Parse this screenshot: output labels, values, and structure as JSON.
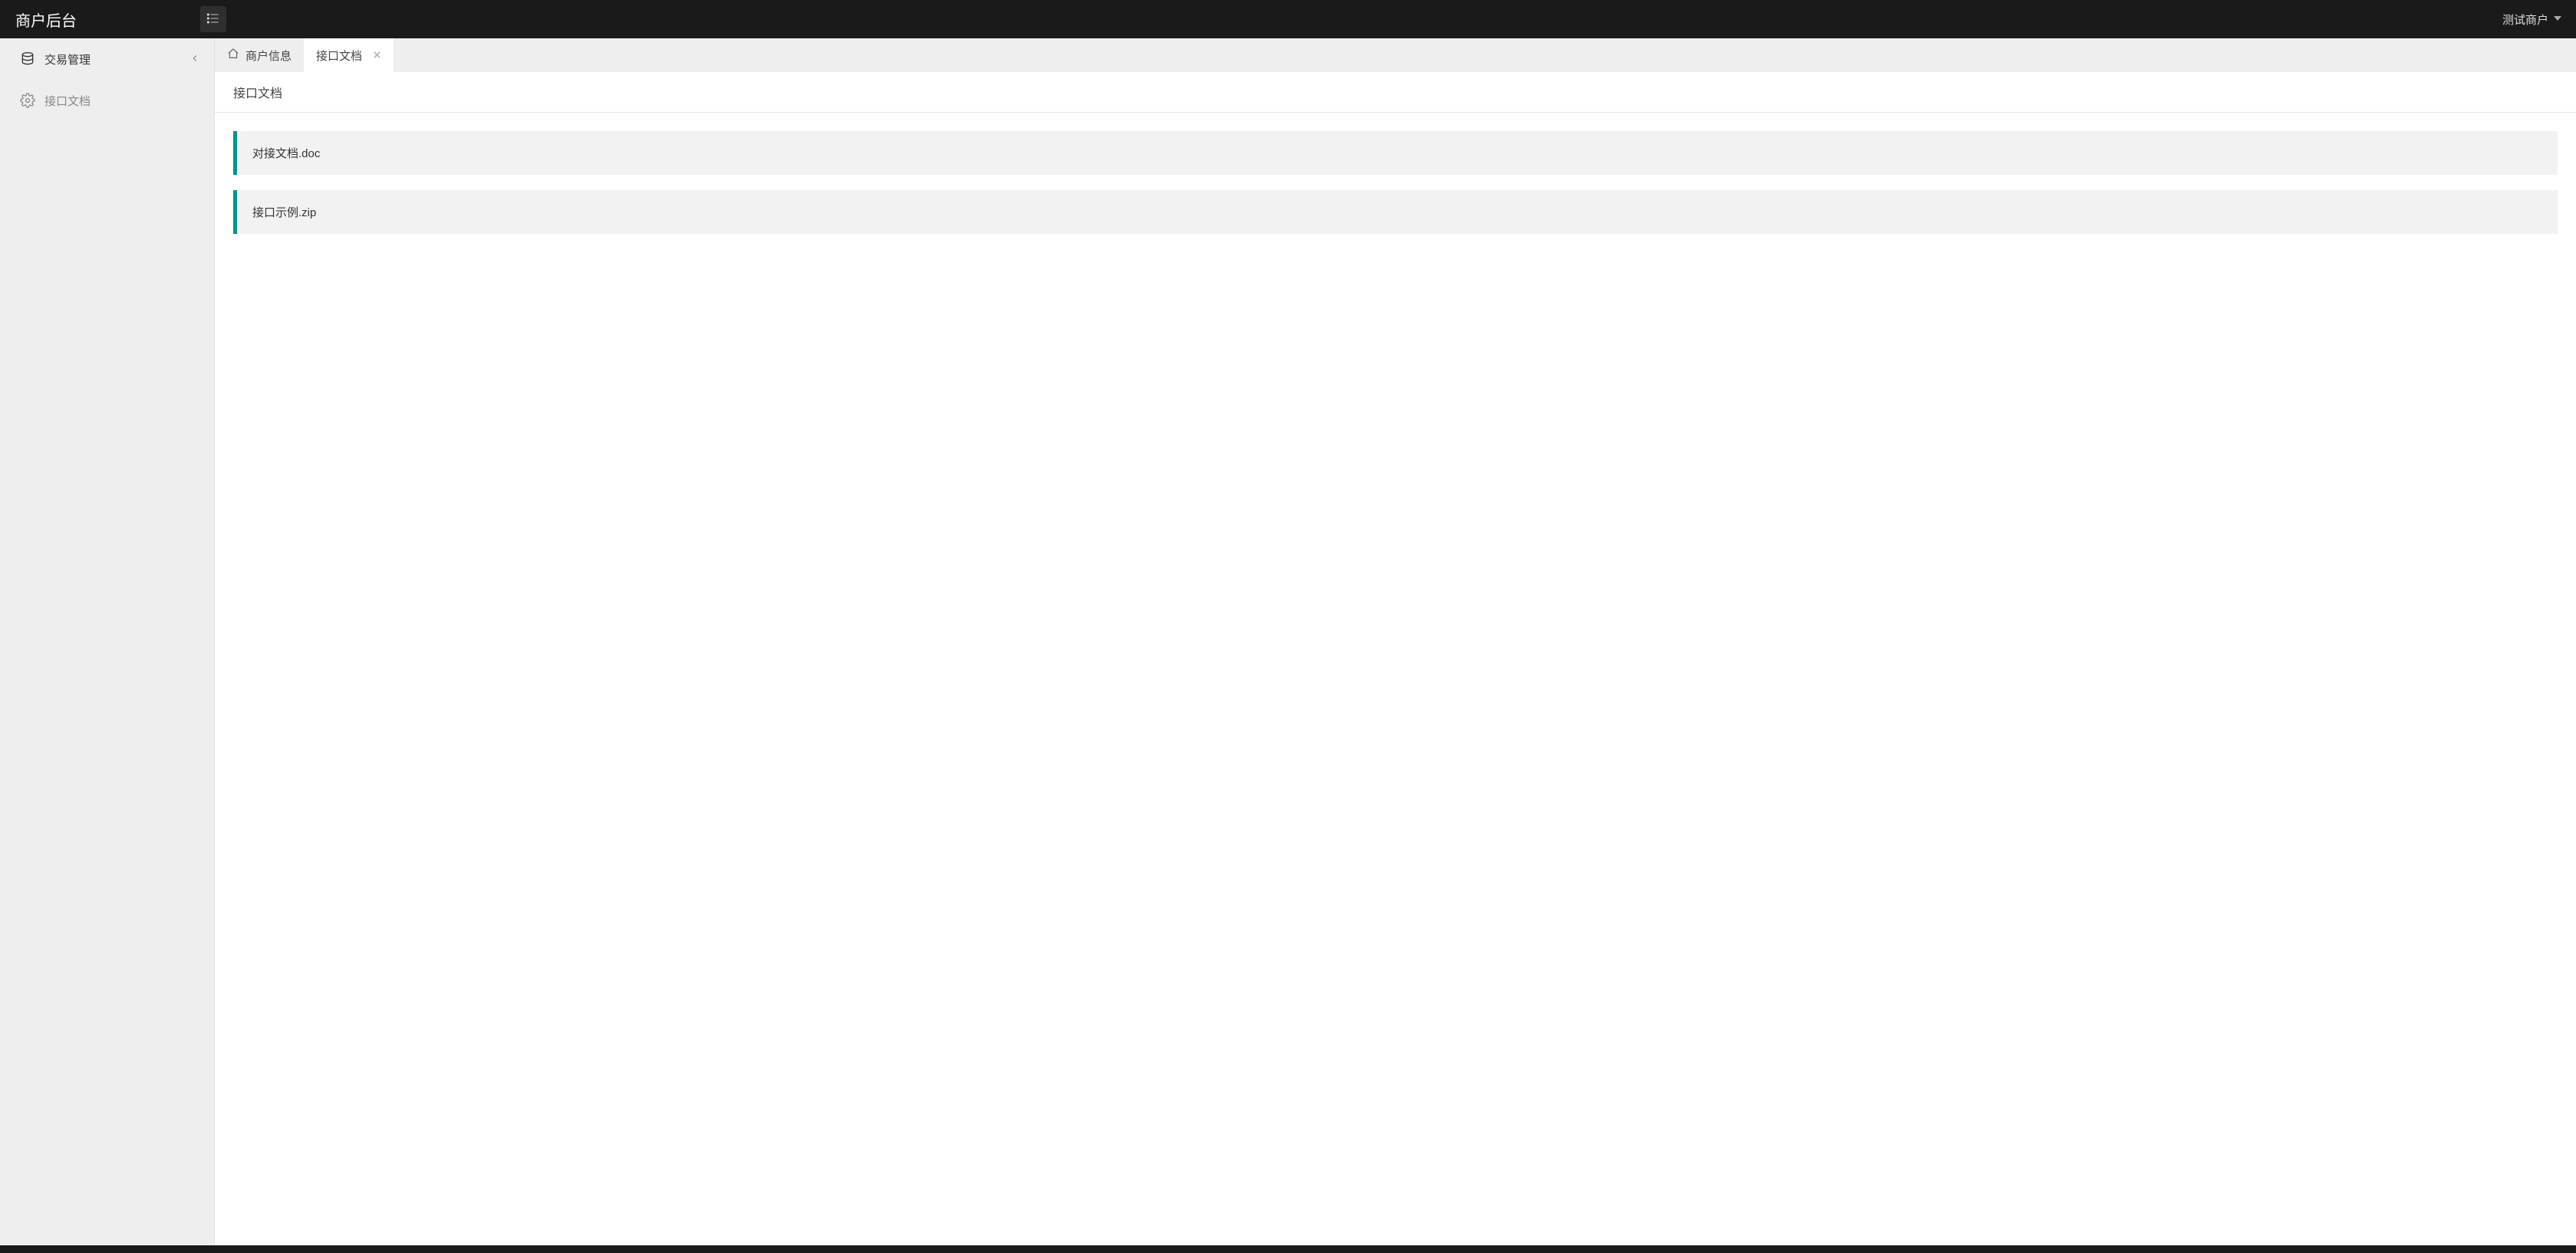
{
  "header": {
    "brand": "商户后台",
    "user_name": "测试商户"
  },
  "sidebar": {
    "items": [
      {
        "label": "交易管理"
      },
      {
        "label": "接口文档"
      }
    ]
  },
  "tabs": [
    {
      "label": "商户信息"
    },
    {
      "label": "接口文档"
    }
  ],
  "page": {
    "title": "接口文档"
  },
  "files": [
    {
      "name": "对接文档.doc"
    },
    {
      "name": "接口示例.zip"
    }
  ],
  "colors": {
    "accent": "#009688"
  }
}
